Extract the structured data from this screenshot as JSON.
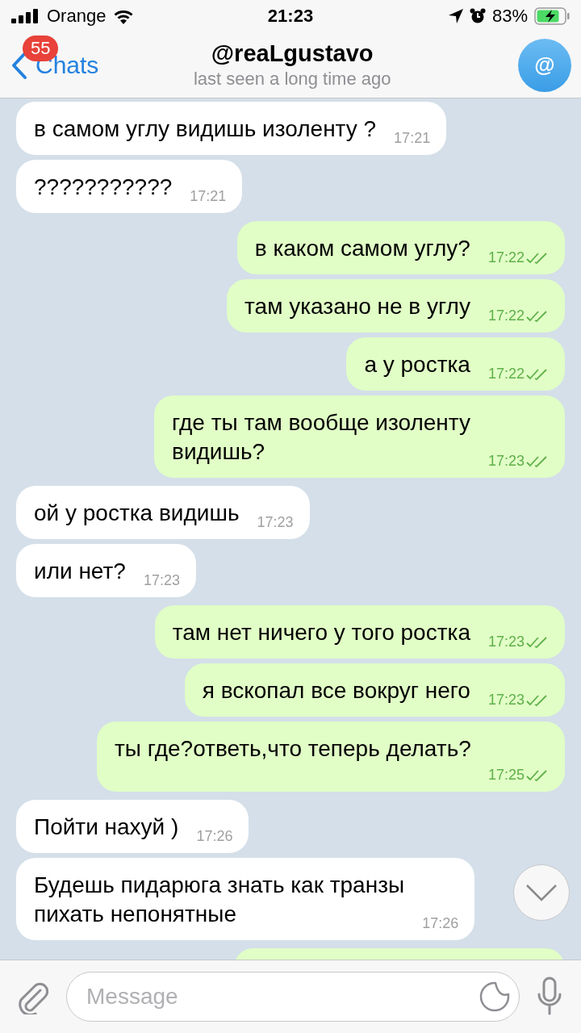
{
  "status_bar": {
    "carrier": "Orange",
    "time": "21:23",
    "battery": "83%",
    "charging": true
  },
  "header": {
    "back_label": "Chats",
    "unread_badge": "55",
    "title": "@reaLgustavo",
    "subtitle": "last seen a long time ago",
    "avatar_text": "@"
  },
  "messages": [
    {
      "kind": "incoming",
      "text": "в самом углу видишь изоленту ?",
      "time": "17:21"
    },
    {
      "kind": "incoming",
      "text": "???????????",
      "time": "17:21"
    },
    {
      "kind": "outgoing",
      "text": "в каком самом углу?",
      "time": "17:22",
      "read": true
    },
    {
      "kind": "outgoing",
      "text": "там указано не в углу",
      "time": "17:22",
      "read": true
    },
    {
      "kind": "outgoing",
      "text": "а у ростка",
      "time": "17:22",
      "read": true
    },
    {
      "kind": "outgoing",
      "text": "где ты там вообще изоленту\nвидишь?",
      "time": "17:23",
      "read": true
    },
    {
      "kind": "incoming",
      "text": "ой у ростка видишь",
      "time": "17:23"
    },
    {
      "kind": "incoming",
      "text": "или нет?",
      "time": "17:23"
    },
    {
      "kind": "outgoing",
      "text": "там нет ничего у того ростка",
      "time": "17:23",
      "read": true
    },
    {
      "kind": "outgoing",
      "text": "я вскопал все вокруг него",
      "time": "17:23",
      "read": true
    },
    {
      "kind": "outgoing",
      "text": "ты где?ответь,что теперь делать?",
      "time": "17:25",
      "read": true
    },
    {
      "kind": "incoming",
      "text": "Пойти нахуй )",
      "time": "17:26"
    },
    {
      "kind": "incoming",
      "text": "Будешь пидарюга знать как транзы\nпихать непонятные",
      "time": "17:26"
    },
    {
      "kind": "outgoing_cut_off"
    }
  ],
  "composer": {
    "placeholder": "Message"
  }
}
